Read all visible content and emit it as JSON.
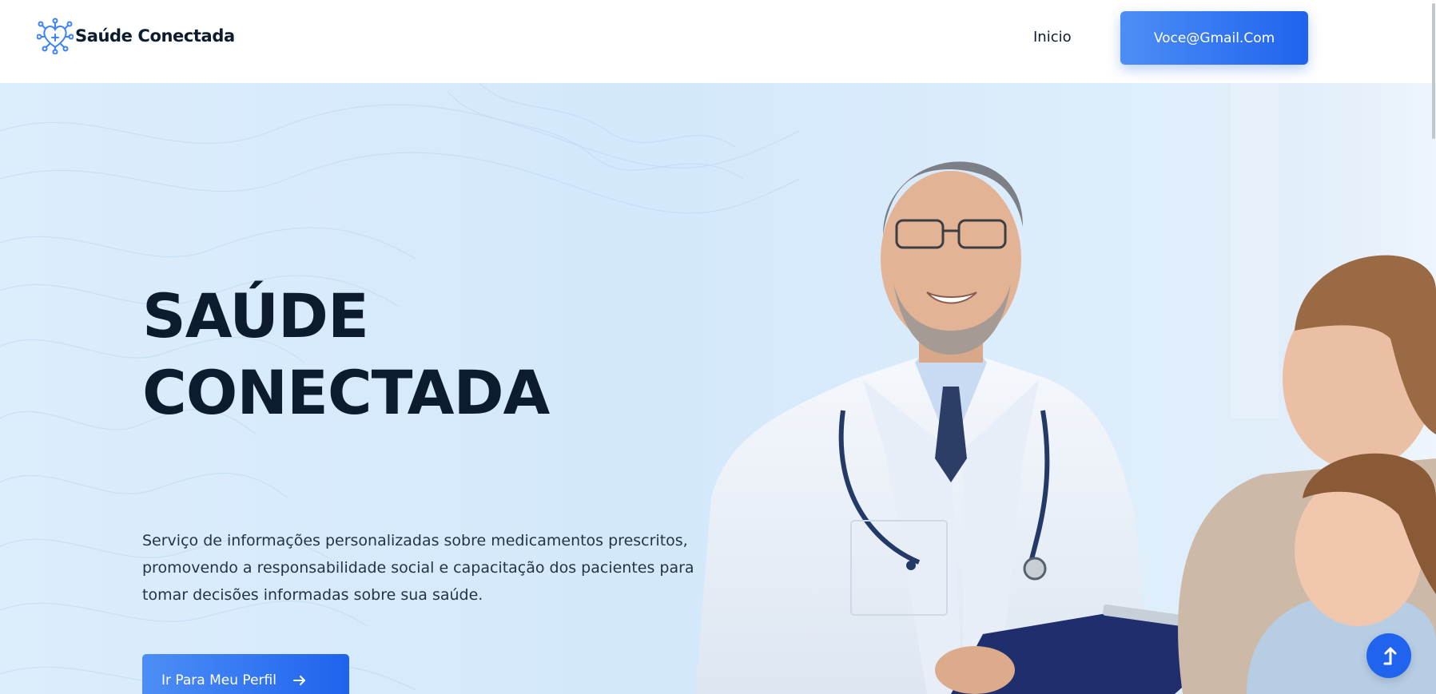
{
  "header": {
    "brand_name": "Saúde Conectada",
    "brand_icon": "heart-circuit-icon",
    "nav": {
      "inicio_label": "Inicio",
      "email_label": "Voce@Gmail.Com"
    }
  },
  "hero": {
    "title_line1": "SAÚDE",
    "title_line2": "CONECTADA",
    "description": "Serviço de informações personalizadas sobre medicamentos prescritos, promovendo a responsabilidade social e capacitação dos pacientes para tomar decisões informadas sobre sua saúde.",
    "cta_label": "Ir Para Meu Perfil",
    "cta_icon": "arrow-right-icon"
  },
  "floating": {
    "scroll_top_icon": "arrow-up-icon"
  },
  "colors": {
    "accent": "#1f63ee",
    "accent_light": "#4d8ef5",
    "heading": "#0d1b2e",
    "hero_bg": "#d3e8fb"
  }
}
